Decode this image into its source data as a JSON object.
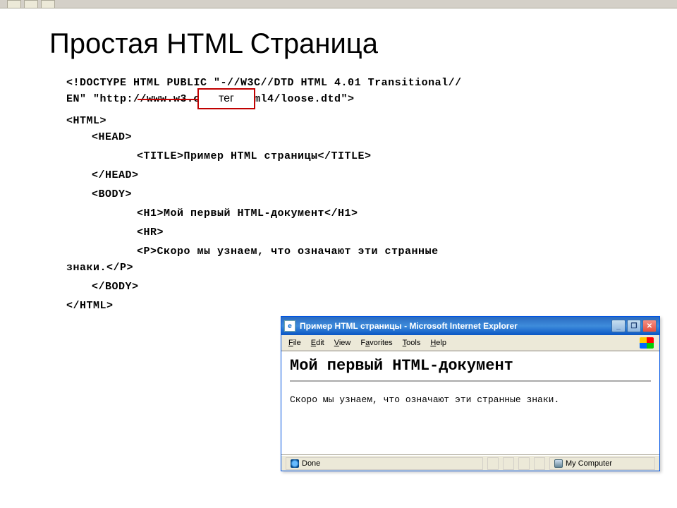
{
  "slide": {
    "title": "Простая HTML Страница",
    "callout_label": "тег",
    "code": {
      "doctype_l1": "<!DOCTYPE HTML PUBLIC \"-//W3C//DTD HTML 4.01 Transitional//",
      "doctype_l2": "EN\" \"http://www.w3.org/TR/html4/loose.dtd\">",
      "html_open": "<HTML>",
      "head_open": "<HEAD>",
      "title_line": "<TITLE>Пример HTML страницы</TITLE>",
      "head_close": "</HEAD>",
      "body_open": "<BODY>",
      "h1_line": "<H1>Мой первый HTML-документ</H1>",
      "hr_line": "<HR>",
      "p_l1": "<P>Скоро мы узнаем, что означают эти странные",
      "p_l2": "знаки.</P>",
      "body_close": "</BODY>",
      "html_close": "</HTML>"
    }
  },
  "ie_window": {
    "title": "Пример HTML страницы - Microsoft Internet Explorer",
    "menu": {
      "file": "File",
      "edit": "Edit",
      "view": "View",
      "favorites": "Favorites",
      "tools": "Tools",
      "help": "Help"
    },
    "content": {
      "h1": "Мой первый HTML-документ",
      "p": "Скоро мы узнаем, что означают эти странные знаки."
    },
    "status": {
      "done": "Done",
      "location": "My Computer"
    }
  }
}
